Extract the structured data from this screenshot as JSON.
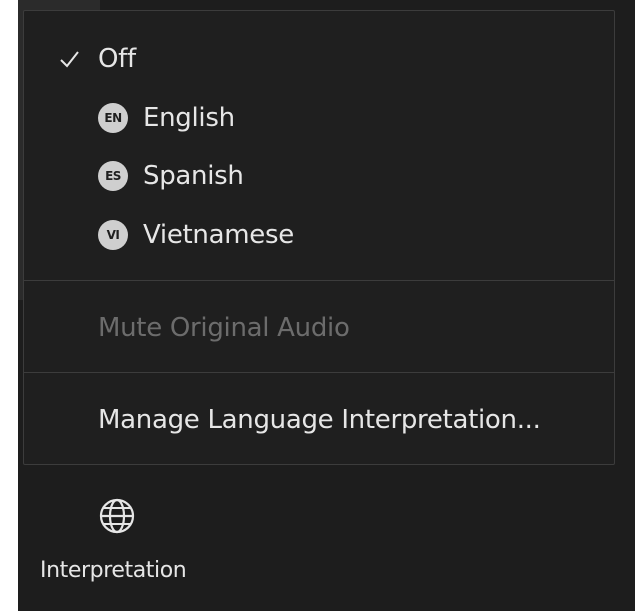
{
  "menu": {
    "items": [
      {
        "label": "Off",
        "checked": true
      },
      {
        "label": "English",
        "badge": "EN"
      },
      {
        "label": "Spanish",
        "badge": "ES"
      },
      {
        "label": "Vietnamese",
        "badge": "VI"
      }
    ],
    "mute_original_audio": "Mute Original Audio",
    "manage": "Manage Language Interpretation..."
  },
  "toolbar": {
    "interpretation_label": "Interpretation"
  },
  "icons": {
    "check": "checkmark-icon",
    "globe": "globe-icon"
  },
  "colors": {
    "menu_bg": "#1f1f1f",
    "toolbar_bg": "#1d1d1d",
    "text": "#e6e6e6",
    "disabled_text": "#6c6c6c",
    "badge_bg": "#cfcfcf"
  }
}
